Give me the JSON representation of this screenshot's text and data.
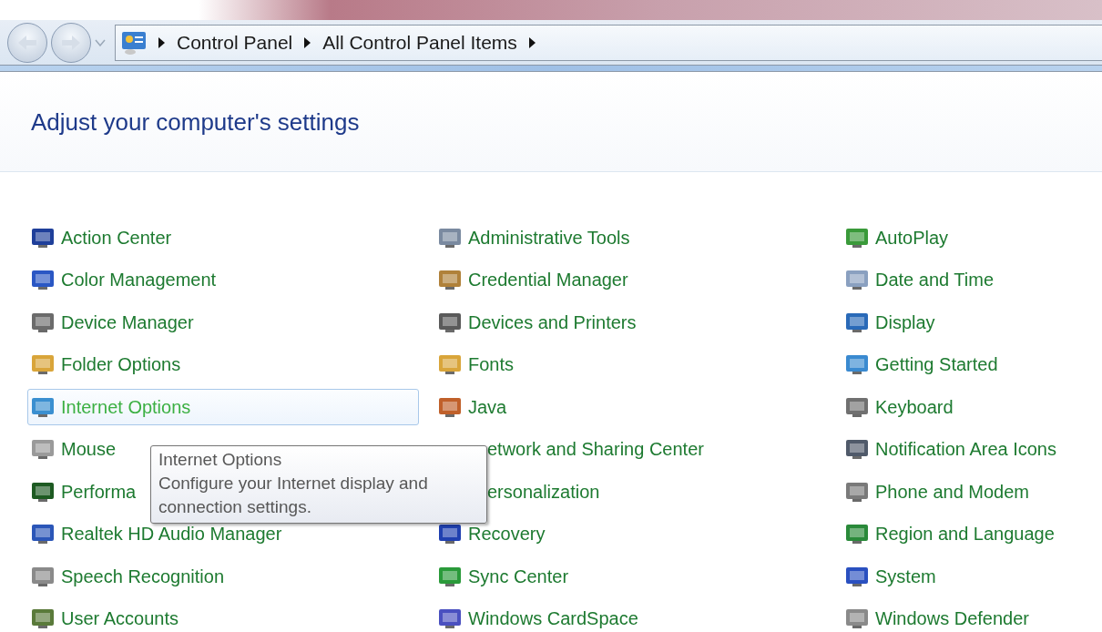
{
  "address_bar": {
    "crumbs": [
      "Control Panel",
      "All Control Panel Items"
    ]
  },
  "title": "Adjust your computer's settings",
  "columns": [
    [
      {
        "label": "Action Center",
        "selected": false,
        "color": "#1f3f9a"
      },
      {
        "label": "Color Management",
        "selected": false,
        "color": "#2a57c4"
      },
      {
        "label": "Device Manager",
        "selected": false,
        "color": "#6b6b6b"
      },
      {
        "label": "Folder Options",
        "selected": false,
        "color": "#d9a53a"
      },
      {
        "label": "Internet Options",
        "selected": true,
        "color": "#3a8fd0"
      },
      {
        "label": "Mouse",
        "selected": false,
        "color": "#9a9a9a"
      },
      {
        "label": "Performa",
        "selected": false,
        "color": "#1d5a22"
      },
      {
        "label": "Realtek HD Audio Manager",
        "selected": false,
        "color": "#2b56b8"
      },
      {
        "label": "Speech Recognition",
        "selected": false,
        "color": "#8a8a8a"
      },
      {
        "label": "User Accounts",
        "selected": false,
        "color": "#5a7a3a"
      }
    ],
    [
      {
        "label": "Administrative Tools",
        "selected": false,
        "color": "#7a8aa0"
      },
      {
        "label": "Credential Manager",
        "selected": false,
        "color": "#b0813a"
      },
      {
        "label": "Devices and Printers",
        "selected": false,
        "color": "#5a5a5a"
      },
      {
        "label": "Fonts",
        "selected": false,
        "color": "#d9a53a"
      },
      {
        "label": "Java",
        "selected": false,
        "color": "#c0602a"
      },
      {
        "label": "etwork and Sharing Center",
        "selected": false,
        "cut": true
      },
      {
        "label": "ersonalization",
        "selected": false,
        "cut": true
      },
      {
        "label": "Recovery",
        "selected": false,
        "color": "#2040b0"
      },
      {
        "label": "Sync Center",
        "selected": false,
        "color": "#2a9a3a"
      },
      {
        "label": "Windows CardSpace",
        "selected": false,
        "color": "#4a50c0"
      }
    ],
    [
      {
        "label": "AutoPlay",
        "selected": false,
        "color": "#3a9a3a"
      },
      {
        "label": "Date and Time",
        "selected": false,
        "color": "#8aa0c0"
      },
      {
        "label": "Display",
        "selected": false,
        "color": "#2a6ab8"
      },
      {
        "label": "Getting Started",
        "selected": false,
        "color": "#3a8ad0"
      },
      {
        "label": "Keyboard",
        "selected": false,
        "color": "#707070"
      },
      {
        "label": "Notification Area Icons",
        "selected": false,
        "color": "#505a6a"
      },
      {
        "label": "Phone and Modem",
        "selected": false,
        "color": "#7a7a7a"
      },
      {
        "label": "Region and Language",
        "selected": false,
        "color": "#2a8a3a"
      },
      {
        "label": "System",
        "selected": false,
        "color": "#2a50c0"
      },
      {
        "label": "Windows Defender",
        "selected": false,
        "color": "#8a8a8a"
      }
    ]
  ],
  "tooltip": {
    "title": "Internet Options",
    "text": "Configure your Internet display and connection settings."
  }
}
